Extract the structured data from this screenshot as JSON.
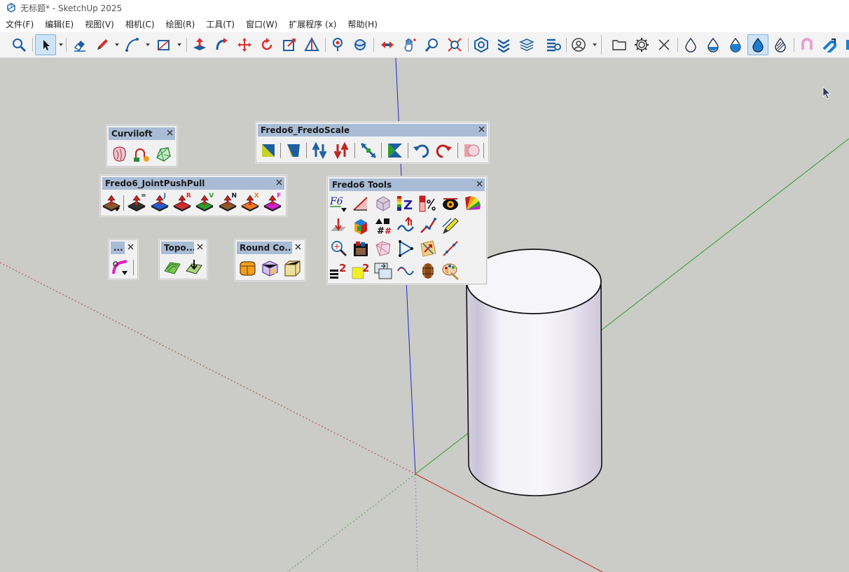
{
  "window": {
    "title": "无标题* - SketchUp 2025"
  },
  "menu": [
    "文件(F)",
    "编辑(E)",
    "视图(V)",
    "相机(C)",
    "绘图(R)",
    "工具(T)",
    "窗口(W)",
    "扩展程序 (x)",
    "帮助(H)"
  ],
  "toolbar": {
    "icons": [
      "zoom-icon",
      "select-arrow-icon",
      "eraser-icon",
      "pencil-line-icon",
      "arc-icon",
      "rectangle-icon",
      "push-pull-icon",
      "follow-me-icon",
      "move-icon",
      "rotate-icon",
      "scale-icon",
      "section-plane-icon",
      "walk-icon",
      "orbit-icon",
      "pan-icon",
      "hand-icon",
      "zoom-window-icon",
      "zoom-extents-icon",
      "warehouse-icon",
      "extension-icon",
      "layers-icon",
      "components-icon",
      "account-icon",
      "folder-icon",
      "gear-icon",
      "close-icon",
      "drop-outline-icon",
      "drop-half-icon",
      "drop-fill-icon",
      "drop-active-icon",
      "drop-striped-icon",
      "magnet-icon",
      "magnet-blue-icon"
    ],
    "active": "drop-active-icon"
  },
  "panels": {
    "curviloft": {
      "title": "Curviloft"
    },
    "fredoscale": {
      "title": "Fredo6_FredoScale"
    },
    "jointpushpull": {
      "title": "Fredo6_JointPushPull",
      "letters": [
        "",
        "=",
        "J",
        "R",
        "V",
        "N",
        "X",
        "F"
      ]
    },
    "fredotools": {
      "title": "Fredo6 Tools",
      "f6_label": "F6",
      "z_label": "Z",
      "num_label": "2"
    },
    "small": {
      "title": "..."
    },
    "topo": {
      "title": "Topo..."
    },
    "roundcorner": {
      "title": "Round Co..."
    }
  },
  "colors": {
    "viewport": "#cbcbc7",
    "panel_title": "#a9bcd6",
    "axis_red": "#c8282a",
    "axis_green": "#2aa02a",
    "axis_blue": "#2626c8",
    "active_button": "#cde4f7"
  }
}
